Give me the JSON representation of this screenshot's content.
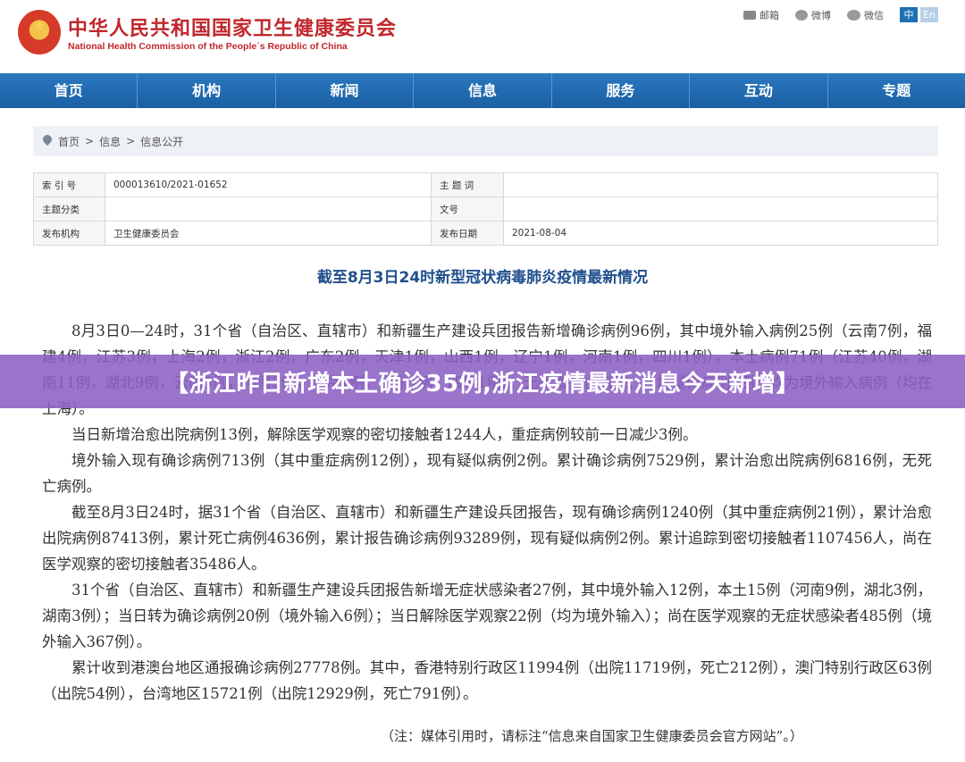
{
  "header": {
    "title_cn": "中华人民共和国国家卫生健康委员会",
    "title_en": "National Health Commission of the People´s Republic of China",
    "links": [
      {
        "label": "邮箱",
        "icon": "mail-icon"
      },
      {
        "label": "微博",
        "icon": "weibo-icon"
      },
      {
        "label": "微信",
        "icon": "wechat-icon"
      }
    ],
    "lang_zh": "中",
    "lang_en": "En"
  },
  "nav": [
    "首页",
    "机构",
    "新闻",
    "信息",
    "服务",
    "互动",
    "专题"
  ],
  "breadcrumb": [
    "首页",
    ">",
    "信息",
    ">",
    "信息公开"
  ],
  "info": {
    "index_label": "索 引 号",
    "index_value": "000013610/2021-01652",
    "keyword_label": "主 题 词",
    "keyword_value": "",
    "category_label": "主题分类",
    "category_value": "",
    "docno_label": "文号",
    "docno_value": "",
    "org_label": "发布机构",
    "org_value": "卫生健康委员会",
    "date_label": "发布日期",
    "date_value": "2021-08-04"
  },
  "article": {
    "title": "截至8月3日24时新型冠状病毒肺炎疫情最新情况",
    "paragraphs": [
      "8月3日0—24时，31个省（自治区、直辖市）和新疆生产建设兵团报告新增确诊病例96例，其中境外输入病例25例（云南7例，福建4例，江苏3例，上海2例，浙江2例，广东2例，天津1例，山西1例，辽宁1例，河南1例，四川1例），本土病例71例（江苏40例，湖南11例，湖北9例，云南5例，河南3例，北京1例，山东1例，四川1例）；无新增死亡病例；新增疑似病例2例，均为境外输入病例（均在上海）。",
      "当日新增治愈出院病例13例，解除医学观察的密切接触者1244人，重症病例较前一日减少3例。",
      "境外输入现有确诊病例713例（其中重症病例12例），现有疑似病例2例。累计确诊病例7529例，累计治愈出院病例6816例，无死亡病例。",
      "截至8月3日24时，据31个省（自治区、直辖市）和新疆生产建设兵团报告，现有确诊病例1240例（其中重症病例21例），累计治愈出院病例87413例，累计死亡病例4636例，累计报告确诊病例93289例，现有疑似病例2例。累计追踪到密切接触者1107456人，尚在医学观察的密切接触者35486人。",
      "31个省（自治区、直辖市）和新疆生产建设兵团报告新增无症状感染者27例，其中境外输入12例，本土15例（河南9例，湖北3例，湖南3例）；当日转为确诊病例20例（境外输入6例）；当日解除医学观察22例（均为境外输入）；尚在医学观察的无症状感染者485例（境外输入367例）。",
      "累计收到港澳台地区通报确诊病例27778例。其中，香港特别行政区11994例（出院11719例，死亡212例），澳门特别行政区63例（出院54例），台湾地区15721例（出院12929例，死亡791例）。"
    ],
    "note": "（注：媒体引用时，请标注“信息来自国家卫生健康委员会官方网站”。）"
  },
  "banner": {
    "text": "【浙江昨日新增本土确诊35例,浙江疫情最新消息今天新增】"
  }
}
